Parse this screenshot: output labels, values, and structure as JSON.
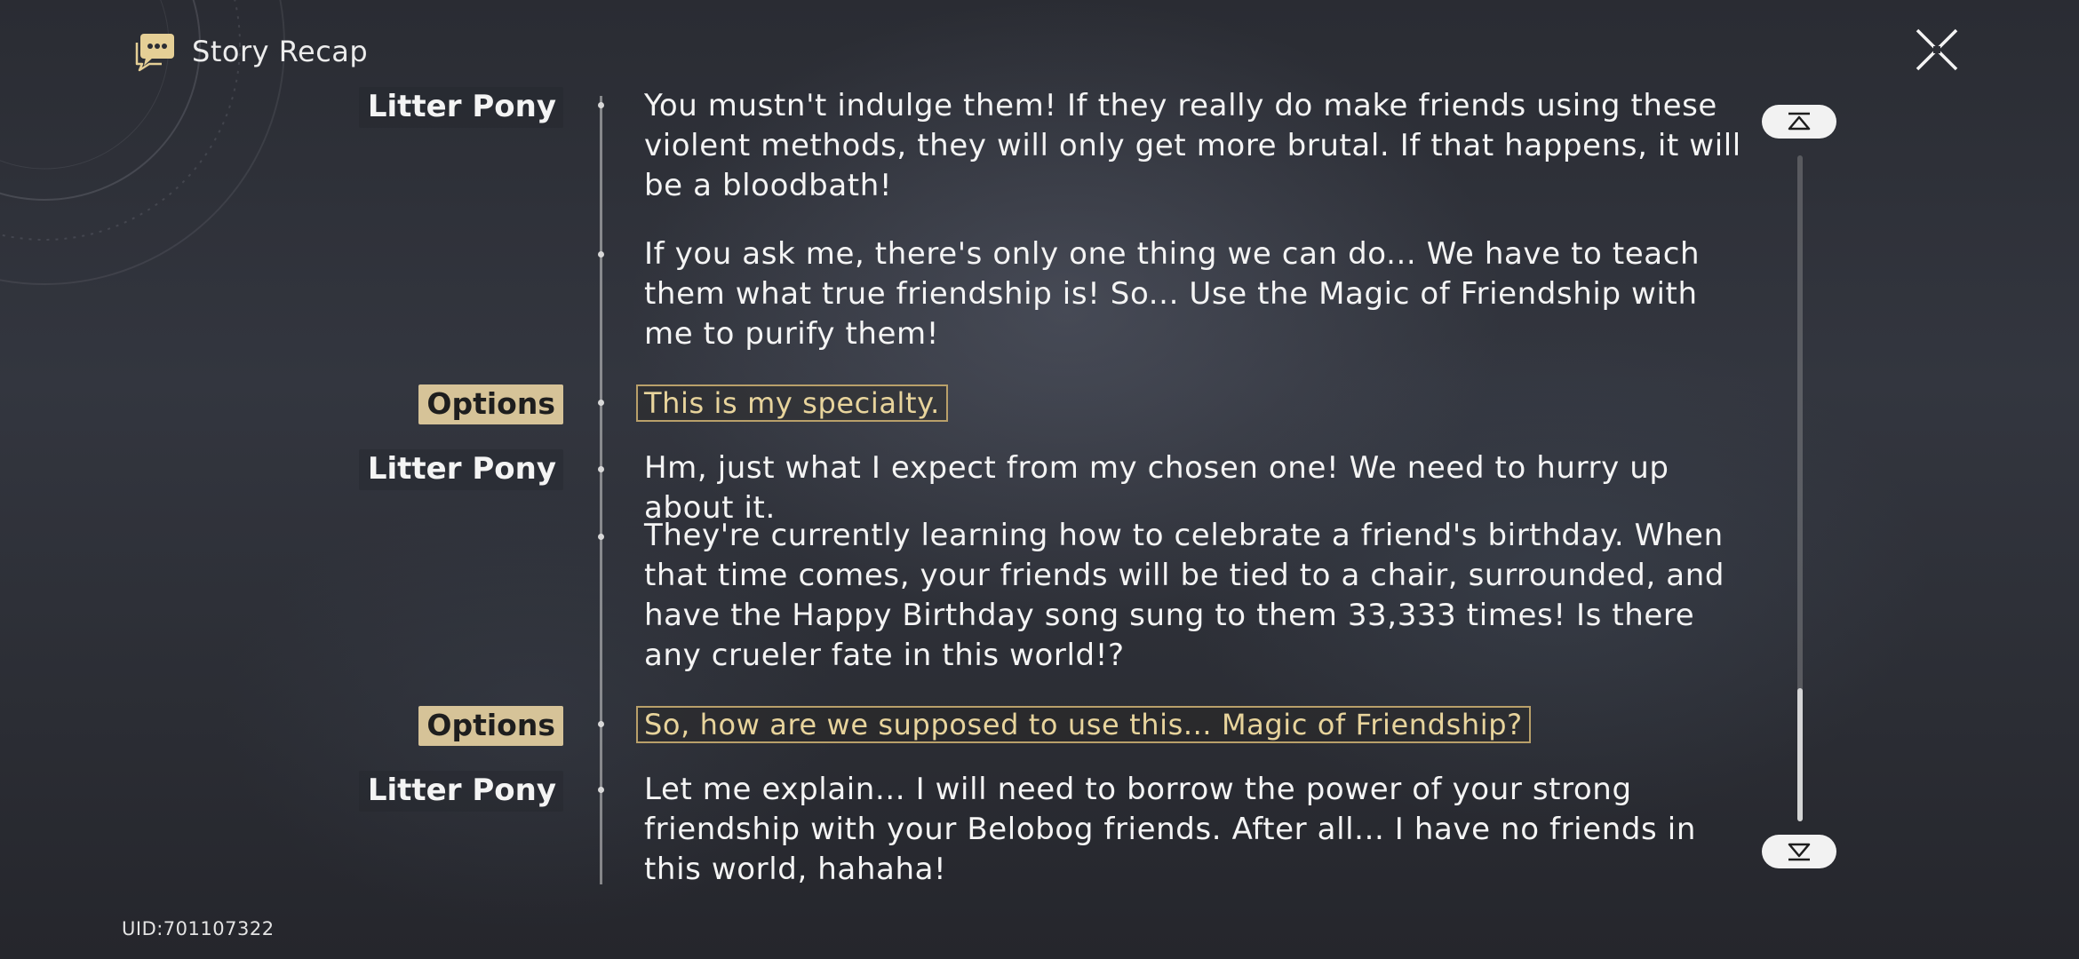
{
  "header": {
    "title": "Story Recap",
    "icon": "chat-bubbles-icon"
  },
  "close_button": {
    "icon": "close-x-icon"
  },
  "uid": "UID:701107322",
  "colors": {
    "accent_gold": "#d6c398",
    "option_text": "#e8d49c",
    "option_border": "#b9a06a",
    "text": "#f4f4f4"
  },
  "dialogue": [
    {
      "speaker": "Litter Pony",
      "lines": [
        "You mustn't indulge them! If they really do make friends using these violent methods, they will only get more brutal. If that happens, it will be a bloodbath!",
        "If you ask me, there's only one thing we can do... We have to teach them what true friendship is! So... Use the Magic of Friendship with me to purify them!"
      ]
    },
    {
      "type": "options",
      "label": "Options",
      "choice": "This is my specialty."
    },
    {
      "speaker": "Litter Pony",
      "lines": [
        "Hm, just what I expect from my chosen one! We need to hurry up about it.",
        "They're currently learning how to celebrate a friend's birthday. When that time comes, your friends will be tied to a chair, surrounded, and have the Happy Birthday song sung to them 33,333 times! Is there any crueler fate in this world!?"
      ]
    },
    {
      "type": "options",
      "label": "Options",
      "choice": "So, how are we supposed to use this... Magic of Friendship?"
    },
    {
      "speaker": "Litter Pony",
      "lines": [
        "Let me explain... I will need to borrow the power of your strong friendship with your Belobog friends. After all... I have no friends in this world, hahaha!"
      ]
    }
  ],
  "scrollbar": {
    "top_button_icon": "scroll-to-top-icon",
    "bottom_button_icon": "scroll-to-bottom-icon",
    "thumb_start_fraction": 0.8,
    "thumb_end_fraction": 1.0
  }
}
